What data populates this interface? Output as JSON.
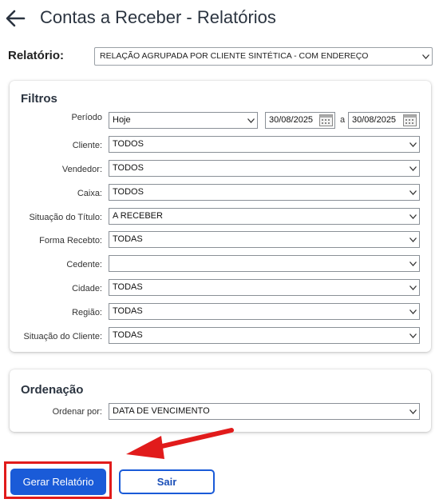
{
  "header": {
    "title": "Contas a Receber - Relatórios"
  },
  "relatorio": {
    "label": "Relatório:",
    "value": "RELAÇÃO AGRUPADA POR CLIENTE SINTÉTICA - COM ENDEREÇO"
  },
  "filtros": {
    "title": "Filtros",
    "periodo": {
      "label": "Período",
      "value": "Hoje",
      "date_from": "30/08/2025",
      "date_sep": "a",
      "date_to": "30/08/2025"
    },
    "fields": [
      {
        "label": "Cliente:",
        "value": "TODOS"
      },
      {
        "label": "Vendedor:",
        "value": "TODOS"
      },
      {
        "label": "Caixa:",
        "value": "TODOS"
      },
      {
        "label": "Situação do Título:",
        "value": "A RECEBER"
      },
      {
        "label": "Forma Recebto:",
        "value": "TODAS"
      },
      {
        "label": "Cedente:",
        "value": ""
      },
      {
        "label": "Cidade:",
        "value": "TODAS"
      },
      {
        "label": "Região:",
        "value": "TODAS"
      },
      {
        "label": "Situação do Cliente:",
        "value": "TODAS"
      }
    ]
  },
  "ordenacao": {
    "title": "Ordenação",
    "label": "Ordenar por:",
    "value": "DATA DE VENCIMENTO"
  },
  "buttons": {
    "gerar": "Gerar Relatório",
    "sair": "Sair"
  },
  "colors": {
    "primary": "#1a5bd8",
    "annotation": "#e11b1b"
  }
}
